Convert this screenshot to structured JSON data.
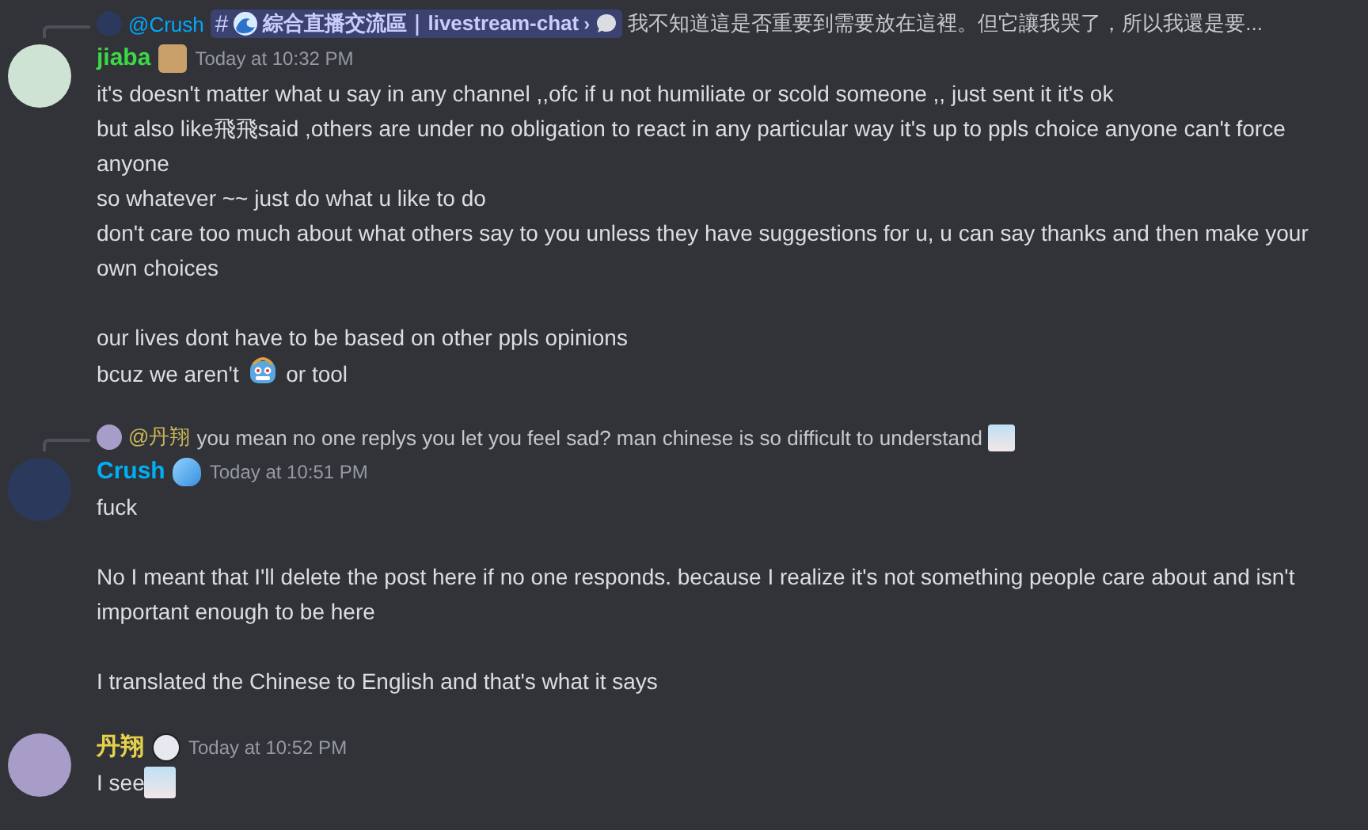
{
  "messages": [
    {
      "reply": {
        "author": "@Crush",
        "color": "#00a8fc",
        "channel": {
          "hash": "#",
          "name": "綜合直播交流區｜livestream-chat",
          "chevron": "›"
        },
        "text": "我不知道這是否重要到需要放在這裡。但它讓我哭了，所以我還是要..."
      },
      "author": "jiaba",
      "color": "#3cd846",
      "time": "Today at 10:32 PM",
      "paragraphs": [
        [
          [
            {
              "kind": "text",
              "text": "it's doesn't matter what u say in any channel ,,ofc if u not humiliate or scold someone ,, just sent it it's ok"
            }
          ],
          [
            {
              "kind": "text",
              "text": "but also like飛飛said ,others are under no obligation to react in any particular way it's up to ppls choice anyone can't force anyone"
            }
          ],
          [
            {
              "kind": "text",
              "text": "so whatever ~~ just do what u like to do"
            }
          ],
          [
            {
              "kind": "text",
              "text": " don't care too much about what others say to you unless they have suggestions for u, u can say thanks and then make your own choices"
            }
          ]
        ],
        [
          [
            {
              "kind": "text",
              "text": "our lives dont have to be based on other ppls opinions"
            }
          ],
          [
            {
              "kind": "text",
              "text": "bcuz we aren't "
            },
            {
              "kind": "robot"
            },
            {
              "kind": "text",
              "text": " or tool"
            }
          ]
        ]
      ]
    },
    {
      "reply": {
        "author": "@丹翔",
        "color": "#c9b458",
        "text": "you mean no one replys you let you feel sad? man chinese is so difficult to understand",
        "trailing_emoji": true
      },
      "author": "Crush",
      "color": "#00b0f4",
      "time": "Today at 10:51 PM",
      "paragraphs": [
        [
          [
            {
              "kind": "text",
              "text": "fuck"
            }
          ]
        ],
        [
          [
            {
              "kind": "text",
              "text": "No I meant that I'll delete the post here if no one responds. because I realize it's not something people care about and isn't important enough to be here"
            }
          ]
        ],
        [
          [
            {
              "kind": "text",
              "text": "I translated the Chinese to English and that's what it says"
            }
          ]
        ]
      ]
    },
    {
      "author": "丹翔",
      "color": "#e6d24a",
      "time": "Today at 10:52 PM",
      "paragraphs": [
        [
          [
            {
              "kind": "text",
              "text": "I see"
            },
            {
              "kind": "face"
            }
          ]
        ]
      ]
    }
  ]
}
